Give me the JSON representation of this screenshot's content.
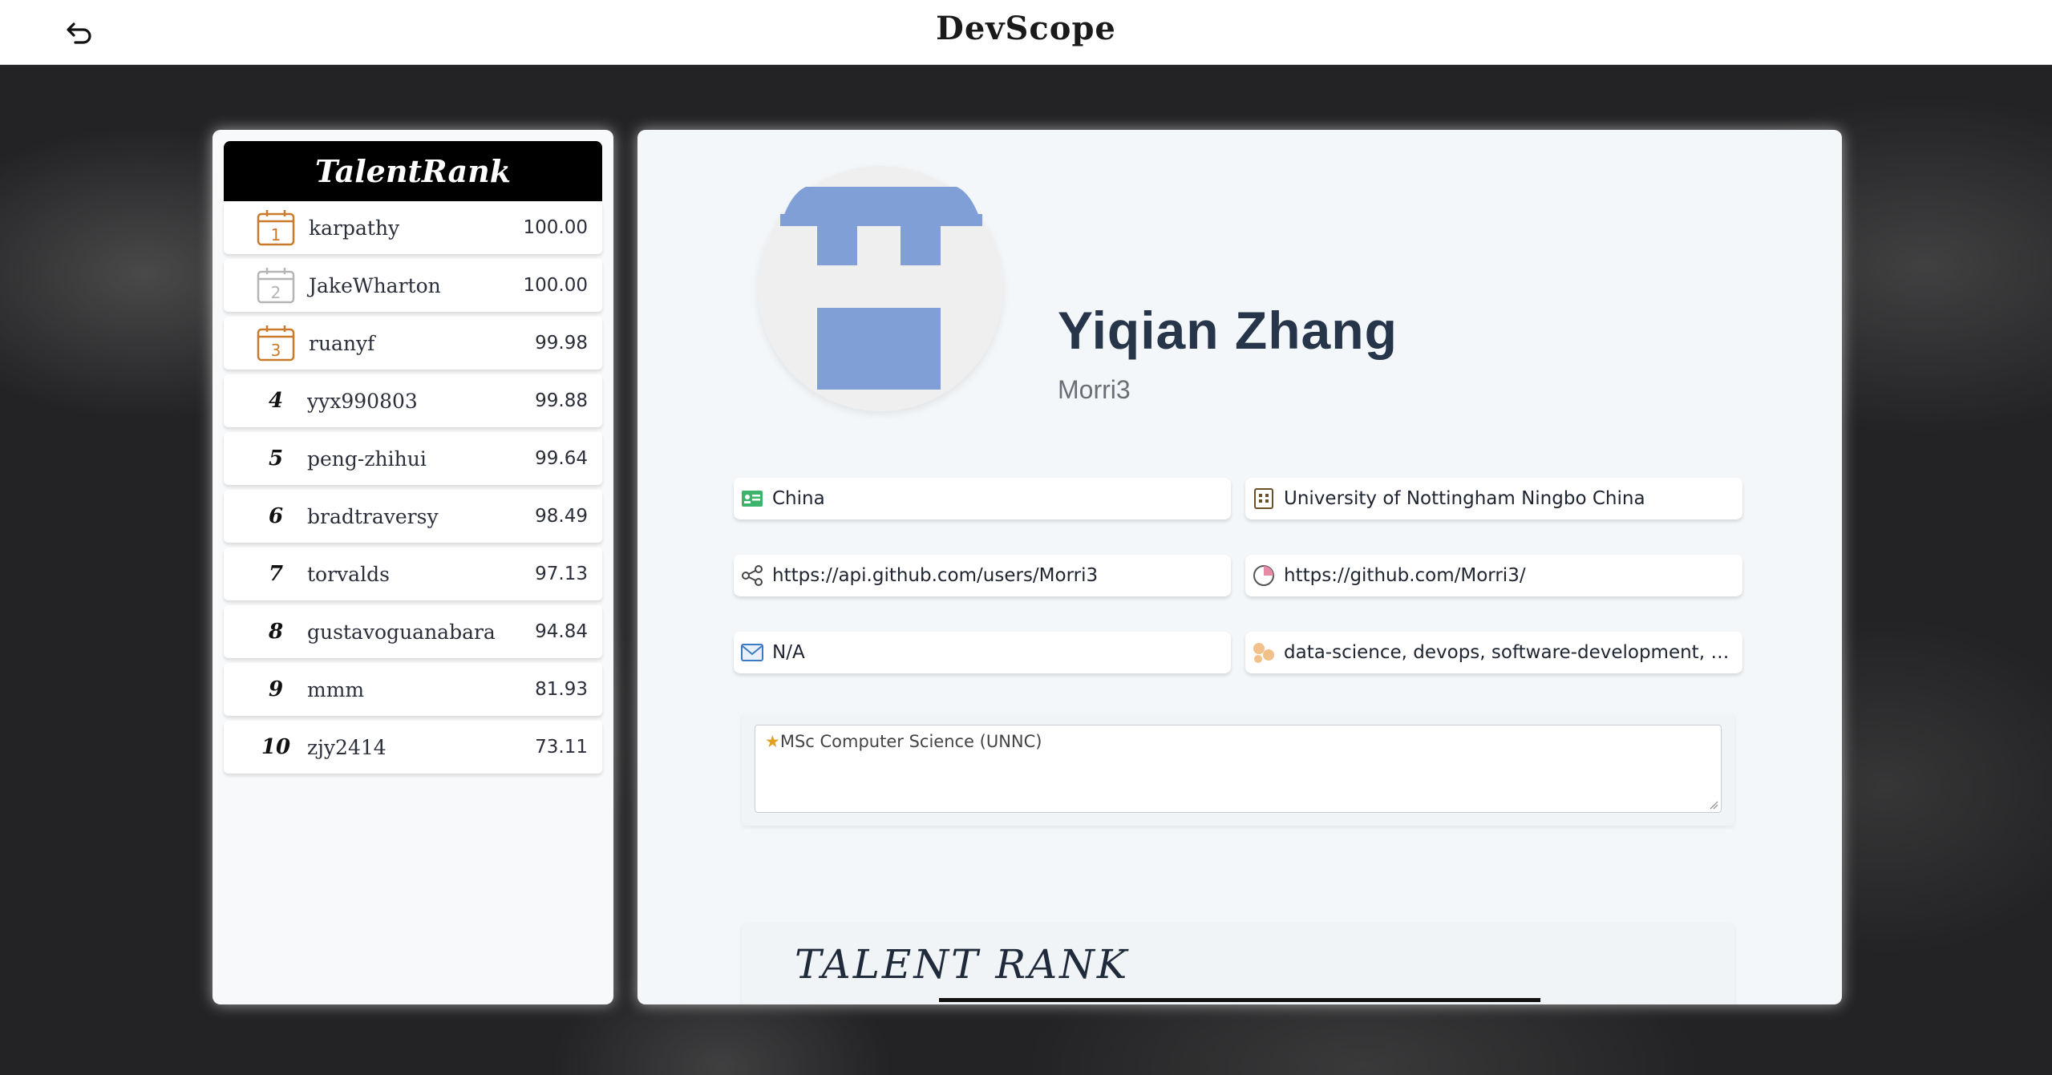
{
  "app": {
    "title": "DevScope"
  },
  "sidebar": {
    "title": "TalentRank",
    "items": [
      {
        "rank": "1",
        "name": "karpathy",
        "score": "100.00",
        "medal_color": "#c97a2b"
      },
      {
        "rank": "2",
        "name": "JakeWharton",
        "score": "100.00",
        "medal_color": "#b5b5b5"
      },
      {
        "rank": "3",
        "name": "ruanyf",
        "score": "99.98",
        "medal_color": "#c97a2b"
      },
      {
        "rank": "4",
        "name": "yyx990803",
        "score": "99.88"
      },
      {
        "rank": "5",
        "name": "peng-zhihui",
        "score": "99.64"
      },
      {
        "rank": "6",
        "name": "bradtraversy",
        "score": "98.49"
      },
      {
        "rank": "7",
        "name": "torvalds",
        "score": "97.13"
      },
      {
        "rank": "8",
        "name": "gustavoguanabara",
        "score": "94.84"
      },
      {
        "rank": "9",
        "name": "mmm",
        "score": "81.93"
      },
      {
        "rank": "10",
        "name": "zjy2414",
        "score": "73.11"
      }
    ]
  },
  "profile": {
    "full_name": "Yiqian Zhang",
    "username": "Morri3",
    "avatar_color": "#7f9fd6",
    "fields": {
      "location": {
        "icon": "id-card-icon",
        "value": "China"
      },
      "company": {
        "icon": "building-icon",
        "value": "University of Nottingham Ningbo China"
      },
      "api_url": {
        "icon": "share-icon",
        "value": "https://api.github.com/users/Morri3"
      },
      "html_url": {
        "icon": "pie-chart-icon",
        "value": "https://github.com/Morri3/"
      },
      "email": {
        "icon": "mail-icon",
        "value": "N/A"
      },
      "topics": {
        "icon": "bubbles-icon",
        "value": "data-science, devops, software-development, m..."
      }
    },
    "bio": "MSc Computer Science (UNNC)",
    "talent_section_title": "TALENT RANK"
  }
}
